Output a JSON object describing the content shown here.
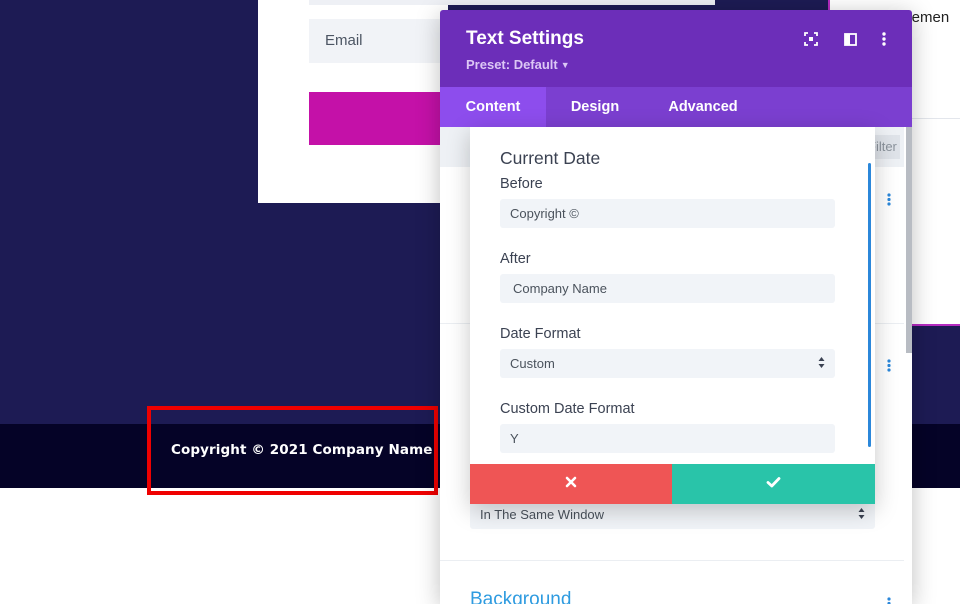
{
  "website": {
    "email_placeholder": "Email",
    "footer_copyright": "Copyright © 2021 Company Name",
    "right_fragment": "elemen"
  },
  "modal": {
    "title": "Text Settings",
    "preset_label": "Preset: Default",
    "header_icons": [
      "expand-icon",
      "split-view-icon",
      "more-options-icon"
    ],
    "tabs": [
      {
        "label": "Content",
        "active": true
      },
      {
        "label": "Design",
        "active": false
      },
      {
        "label": "Advanced",
        "active": false
      }
    ],
    "filter_label": "Filter",
    "link_target_value": "In The Same Window",
    "background_section": "Background"
  },
  "popup": {
    "title": "Current Date",
    "fields": {
      "before": {
        "label": "Before",
        "value": "Copyright ©"
      },
      "after": {
        "label": "After",
        "value": "Company Name"
      },
      "date_format": {
        "label": "Date Format",
        "value": "Custom"
      },
      "custom_format": {
        "label": "Custom Date Format",
        "value": "Y"
      }
    },
    "cancel_icon": "close-icon",
    "save_icon": "checkmark-icon"
  },
  "colors": {
    "site_bg": "#1d1b54",
    "footer_bg": "#050327",
    "header_purple": "#6c2eb9",
    "active_tab": "#8d4ded",
    "cancel_red": "#ef5555",
    "save_green": "#29c4a9",
    "highlight_red": "#ef0000",
    "accent_blue": "#2b87da",
    "submit_magenta": "#c411a8"
  }
}
